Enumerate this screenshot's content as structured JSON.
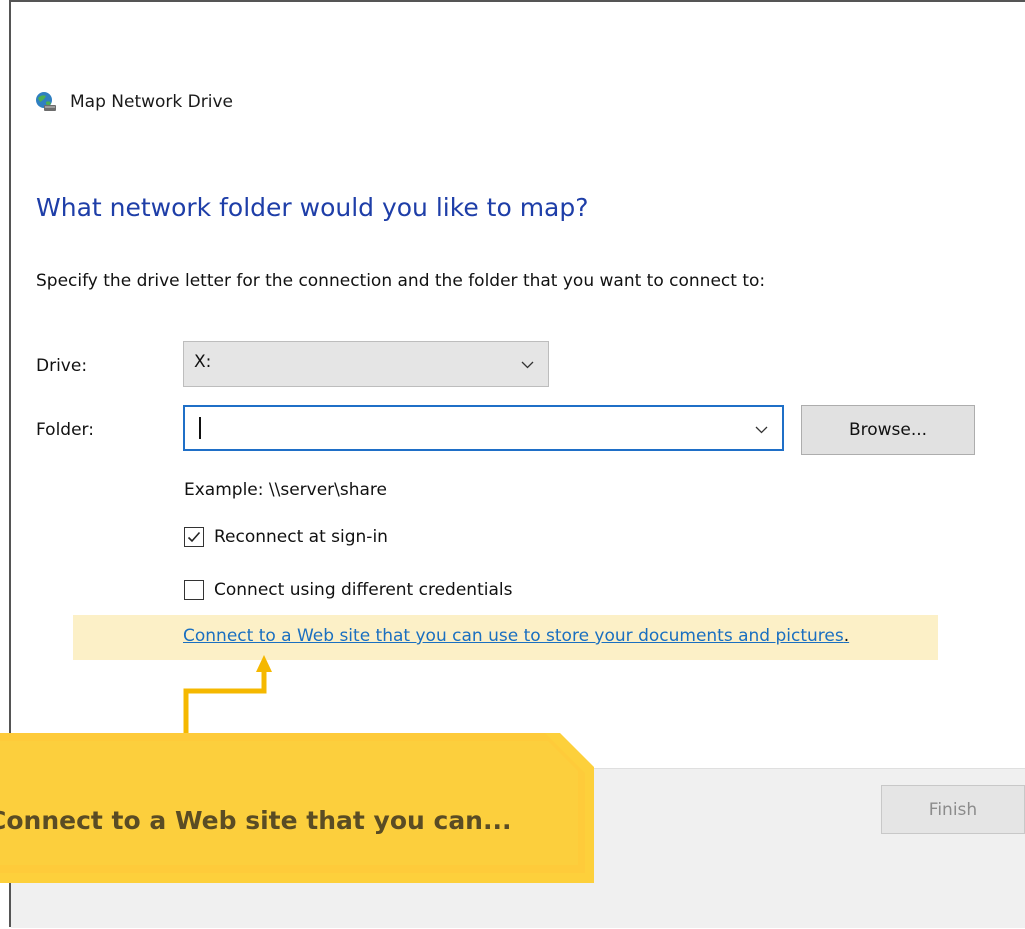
{
  "window": {
    "title": "Map Network Drive",
    "icon": "network-drive-icon"
  },
  "heading": "What network folder would you like to map?",
  "instruction": "Specify the drive letter for the connection and the folder that you want to connect to:",
  "drive": {
    "label": "Drive:",
    "value": "X:"
  },
  "folder": {
    "label": "Folder:",
    "value": "",
    "browse_label": "Browse..."
  },
  "example": "Example: \\\\server\\share",
  "reconnect": {
    "label": "Reconnect at sign-in",
    "checked": true
  },
  "credentials": {
    "label": "Connect using different credentials",
    "checked": false
  },
  "web_link": {
    "text": "Connect to a Web site that you can use to store your documents and pictures",
    "suffix": "."
  },
  "callout": {
    "text": "Connect to a Web site that you can..."
  },
  "footer": {
    "finish_label": "Finish"
  },
  "colors": {
    "heading": "#1e3ea8",
    "link": "#1a6fc0",
    "callout": "#fdd03b",
    "highlight": "#fcf0c7",
    "focus_border": "#1f6fc7"
  }
}
